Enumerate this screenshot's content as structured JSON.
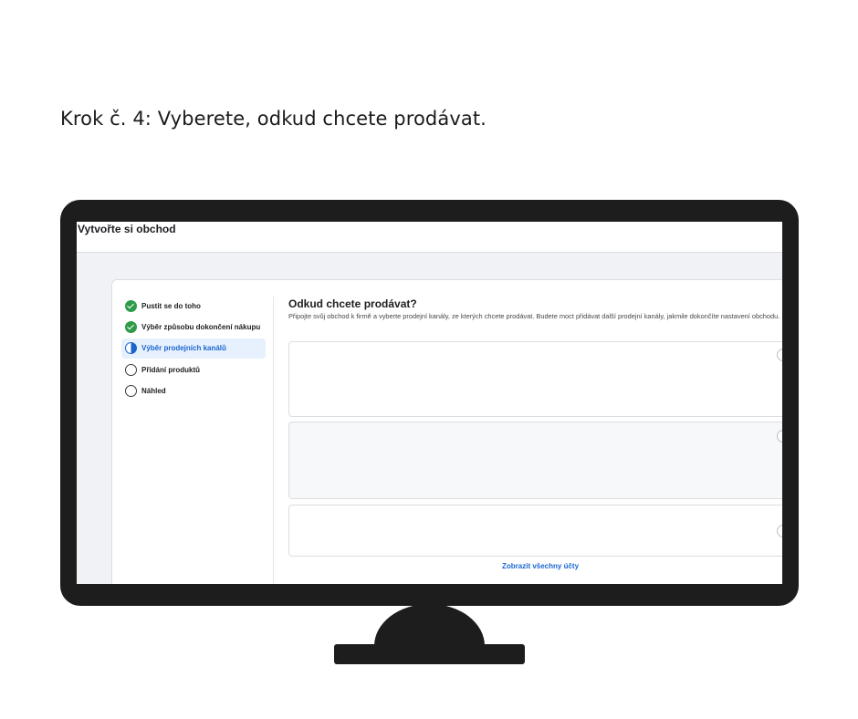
{
  "heading": "Krok č. 4: Vyberete, odkud chcete prodávat.",
  "app": {
    "title": "Vytvořte si obchod"
  },
  "steps": [
    {
      "label": "Pustit se do toho",
      "state": "done"
    },
    {
      "label": "Výběr způsobu dokončení nákupu",
      "state": "done"
    },
    {
      "label": "Výběr prodejních kanálů",
      "state": "active"
    },
    {
      "label": "Přidání produktů",
      "state": "todo"
    },
    {
      "label": "Náhled",
      "state": "todo"
    }
  ],
  "panel": {
    "title": "Odkud chcete prodávat?",
    "description": "Připojte svůj obchod k firmě a vyberte prodejní kanály, ze kterých chcete prodávat. Budete moct přidávat další prodejní kanály, jakmile dokončíte nastavení obchodu."
  },
  "show_all_link": "Zobrazit všechny účty",
  "colors": {
    "monitor": "#1d1d1d",
    "accent": "#1a66d1",
    "done": "#2e9b48"
  }
}
